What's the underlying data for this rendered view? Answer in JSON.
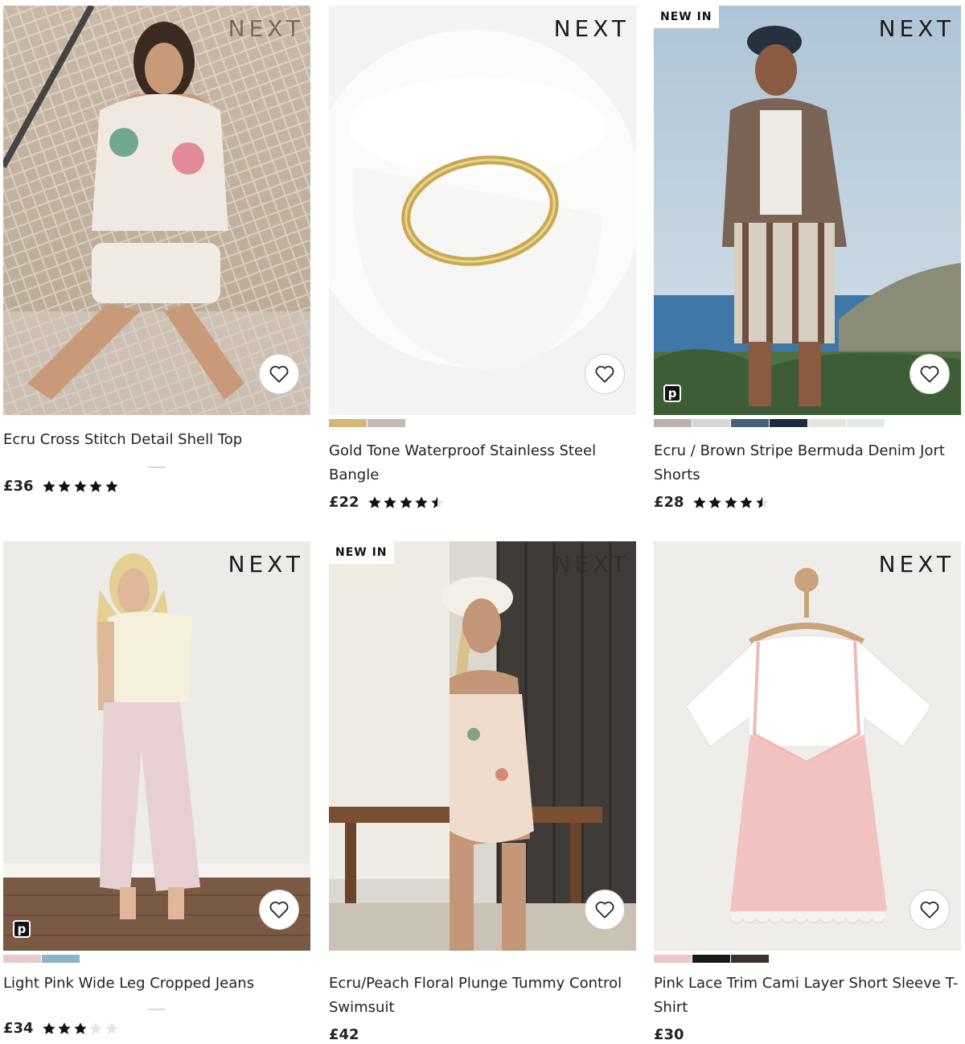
{
  "brand_label": "NEXT",
  "new_in_label": "NEW IN",
  "pay_badge": "p",
  "products": [
    {
      "title": "Ecru Cross Stitch Detail Shell Top",
      "price": "£36",
      "rating": 5,
      "new_in": false,
      "pay_badge": false,
      "swatches": []
    },
    {
      "title": "Gold Tone Waterproof Stainless Steel Bangle",
      "price": "£22",
      "rating": 4.5,
      "new_in": false,
      "pay_badge": false,
      "swatches": [
        "#d4b877",
        "#bfbcb6"
      ]
    },
    {
      "title": "Ecru / Brown Stripe Bermuda Denim Jort Shorts",
      "price": "£28",
      "rating": 4.5,
      "new_in": true,
      "pay_badge": true,
      "swatches": [
        "#b9b2ad",
        "#d7d6d6",
        "#466276",
        "#1e2a3c",
        "#e7e5df",
        "#e3ebe6"
      ]
    },
    {
      "title": "Light Pink Wide Leg Cropped Jeans",
      "price": "£34",
      "rating": 3,
      "new_in": false,
      "pay_badge": true,
      "swatches": [
        "#e8c9cd",
        "#8db4c8"
      ]
    },
    {
      "title": "Ecru/Peach Floral Plunge Tummy Control Swimsuit",
      "price": "£42",
      "rating": null,
      "new_in": true,
      "pay_badge": false,
      "swatches": []
    },
    {
      "title": "Pink Lace Trim Cami Layer Short Sleeve T-Shirt",
      "price": "£30",
      "rating": null,
      "new_in": false,
      "pay_badge": false,
      "swatches": [
        "#efc6c6",
        "#1a1a1a",
        "#3b322c"
      ]
    }
  ],
  "icons": {
    "favourite": "heart-outline-icon",
    "star_full": "star-filled-icon",
    "star_half": "star-half-icon",
    "star_empty": "star-empty-icon"
  }
}
